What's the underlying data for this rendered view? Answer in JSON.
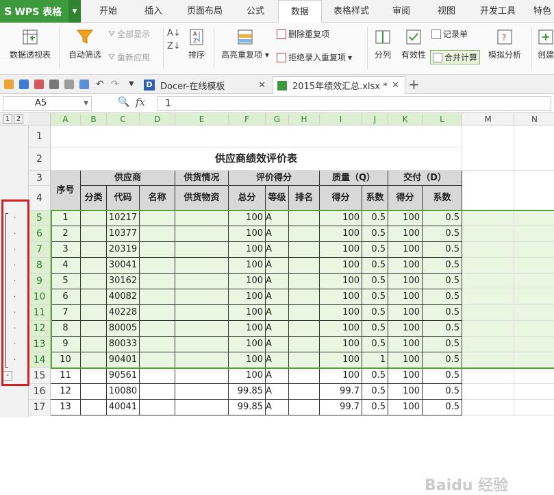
{
  "app": {
    "logo": "WPS 表格",
    "logo_glyph": "S"
  },
  "menu_tabs": [
    "开始",
    "插入",
    "页面布局",
    "公式",
    "数据",
    "表格样式",
    "审阅",
    "视图",
    "开发工具",
    "特色"
  ],
  "active_tab": "数据",
  "ribbon": {
    "pivot": "数据透视表",
    "autofilter": "自动筛选",
    "show_all": "全部显示",
    "reapply": "重新应用",
    "sort": "排序",
    "highlight_dup": "高亮重复项",
    "remove_dup": "删除重复项",
    "reject_dup": "拒绝录入重复项",
    "split": "分列",
    "validity": "有效性",
    "records": "记录单",
    "consolidate": "合并计算",
    "simulate": "模拟分析",
    "create": "创建"
  },
  "doc_tabs": [
    {
      "label": "Docer-在线模板"
    },
    {
      "label": "2015年绩效汇总.xlsx *"
    }
  ],
  "formula_bar": {
    "name_box": "A5",
    "fx": "fx",
    "value": "1"
  },
  "outline_levels": [
    "1",
    "2"
  ],
  "collapse_sign": "-",
  "columns": [
    "A",
    "B",
    "C",
    "D",
    "E",
    "F",
    "G",
    "H",
    "I",
    "J",
    "K",
    "L",
    "M",
    "N"
  ],
  "table": {
    "title": "供应商绩效评价表",
    "hdr": {
      "seq": "序号",
      "supplier": "供应商",
      "supply": "供货情况",
      "rating": "评价得分",
      "quality": "质量（Q）",
      "delivery": "交付（D）",
      "cat": "分类",
      "code": "代码",
      "name": "名称",
      "goods": "供货物资",
      "total": "总分",
      "grade": "等级",
      "rank": "排名",
      "q_score": "得分",
      "q_coef": "系数",
      "d_score": "得分",
      "d_coef": "系数"
    },
    "rows": [
      {
        "row": "5",
        "seq": "1",
        "code": "10217",
        "total": "100",
        "grade": "A",
        "q": "100",
        "qc": "0.5",
        "d": "100",
        "dc": "0.5"
      },
      {
        "row": "6",
        "seq": "2",
        "code": "10377",
        "total": "100",
        "grade": "A",
        "q": "100",
        "qc": "0.5",
        "d": "100",
        "dc": "0.5"
      },
      {
        "row": "7",
        "seq": "3",
        "code": "20319",
        "total": "100",
        "grade": "A",
        "q": "100",
        "qc": "0.5",
        "d": "100",
        "dc": "0.5"
      },
      {
        "row": "8",
        "seq": "4",
        "code": "30041",
        "total": "100",
        "grade": "A",
        "q": "100",
        "qc": "0.5",
        "d": "100",
        "dc": "0.5"
      },
      {
        "row": "9",
        "seq": "5",
        "code": "30162",
        "total": "100",
        "grade": "A",
        "q": "100",
        "qc": "0.5",
        "d": "100",
        "dc": "0.5"
      },
      {
        "row": "10",
        "seq": "6",
        "code": "40082",
        "total": "100",
        "grade": "A",
        "q": "100",
        "qc": "0.5",
        "d": "100",
        "dc": "0.5"
      },
      {
        "row": "11",
        "seq": "7",
        "code": "40228",
        "total": "100",
        "grade": "A",
        "q": "100",
        "qc": "0.5",
        "d": "100",
        "dc": "0.5"
      },
      {
        "row": "12",
        "seq": "8",
        "code": "80005",
        "total": "100",
        "grade": "A",
        "q": "100",
        "qc": "0.5",
        "d": "100",
        "dc": "0.5"
      },
      {
        "row": "13",
        "seq": "9",
        "code": "80033",
        "total": "100",
        "grade": "A",
        "q": "100",
        "qc": "0.5",
        "d": "100",
        "dc": "0.5"
      },
      {
        "row": "14",
        "seq": "10",
        "code": "90401",
        "total": "100",
        "grade": "A",
        "q": "100",
        "qc": "1",
        "d": "100",
        "dc": "0.5"
      },
      {
        "row": "15",
        "seq": "11",
        "code": "90561",
        "total": "100",
        "grade": "A",
        "q": "100",
        "qc": "0.5",
        "d": "100",
        "dc": "0.5"
      },
      {
        "row": "16",
        "seq": "12",
        "code": "10080",
        "total": "99.85",
        "grade": "A",
        "q": "99.7",
        "qc": "0.5",
        "d": "100",
        "dc": "0.5"
      },
      {
        "row": "17",
        "seq": "13",
        "code": "40041",
        "total": "99.85",
        "grade": "A",
        "q": "99.7",
        "qc": "0.5",
        "d": "100",
        "dc": "0.5"
      }
    ]
  },
  "watermark": "Baidu 经验",
  "colors": {
    "accent": "#3c9a3c",
    "selection": "#e9f6e1",
    "outline_box": "#d21f1f"
  }
}
